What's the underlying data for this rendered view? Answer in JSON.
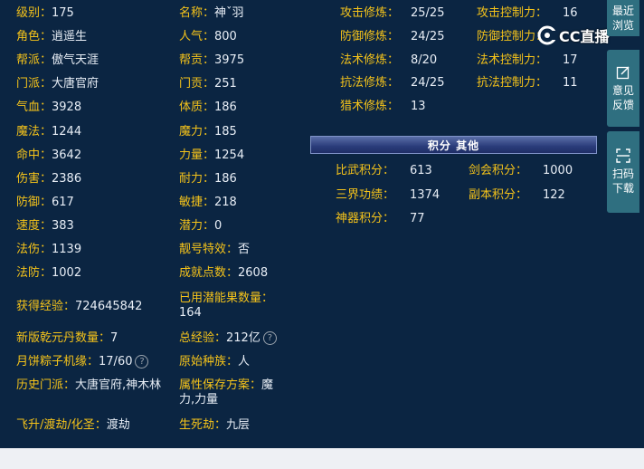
{
  "left_stats": [
    {
      "label": "级别：",
      "value": "175"
    },
    {
      "label": "角色：",
      "value": "逍遥生"
    },
    {
      "label": "帮派：",
      "value": "傲气天涯"
    },
    {
      "label": "门派：",
      "value": "大唐官府"
    },
    {
      "label": "气血：",
      "value": "3928"
    },
    {
      "label": "魔法：",
      "value": "1244"
    },
    {
      "label": "命中：",
      "value": "3642"
    },
    {
      "label": "伤害：",
      "value": "2386"
    },
    {
      "label": "防御：",
      "value": "617"
    },
    {
      "label": "速度：",
      "value": "383"
    },
    {
      "label": "法伤：",
      "value": "1139"
    },
    {
      "label": "法防：",
      "value": "1002"
    }
  ],
  "mid_stats": [
    {
      "label": "名称：",
      "value": "神ˇ羽"
    },
    {
      "label": "人气：",
      "value": "800"
    },
    {
      "label": "帮贡：",
      "value": "3975"
    },
    {
      "label": "门贡：",
      "value": "251"
    },
    {
      "label": "体质：",
      "value": "186"
    },
    {
      "label": "魔力：",
      "value": "185"
    },
    {
      "label": "力量：",
      "value": "1254"
    },
    {
      "label": "耐力：",
      "value": "186"
    },
    {
      "label": "敏捷：",
      "value": "218"
    },
    {
      "label": "潜力：",
      "value": "0"
    },
    {
      "label": "靓号特效：",
      "value": "否"
    },
    {
      "label": "成就点数：",
      "value": "2608"
    }
  ],
  "extra": {
    "exp_label": "获得经验：",
    "exp_value": "724645842",
    "potion_label": "已用潜能果数量：",
    "potion_value": "164",
    "qianyuan_label": "新版乾元丹数量：",
    "qianyuan_value": "7",
    "total_exp_label": "总经验：",
    "total_exp_value": "212亿",
    "mooncake_label": "月饼粽子机缘：",
    "mooncake_value": "17/60",
    "race_label": "原始种族：",
    "race_value": "人",
    "history_label": "历史门派：",
    "history_value": "大唐官府,神木林",
    "attr_save_label": "属性保存方案：",
    "attr_save_value": "魔力,力量",
    "ascend_label": "飞升/渡劫/化圣：",
    "ascend_value": "渡劫",
    "life_death_label": "生死劫：",
    "life_death_value": "九层"
  },
  "cultivation_left": [
    {
      "label": "攻击修炼：",
      "value": "25/25"
    },
    {
      "label": "防御修炼：",
      "value": "24/25"
    },
    {
      "label": "法术修炼：",
      "value": "8/20"
    },
    {
      "label": "抗法修炼：",
      "value": "24/25"
    },
    {
      "label": "猎术修炼：",
      "value": "13"
    }
  ],
  "cultivation_right": [
    {
      "label": "攻击控制力：",
      "value": "16"
    },
    {
      "label": "防御控制力：",
      "value": ""
    },
    {
      "label": "法术控制力：",
      "value": "17"
    },
    {
      "label": "抗法控制力：",
      "value": "11"
    }
  ],
  "points_header": "积分 其他",
  "points_left": [
    {
      "label": "比武积分：",
      "value": "613"
    },
    {
      "label": "三界功绩：",
      "value": "1374"
    },
    {
      "label": "神器积分：",
      "value": "77"
    }
  ],
  "points_right": [
    {
      "label": "剑会积分：",
      "value": "1000"
    },
    {
      "label": "副本积分：",
      "value": "122"
    }
  ],
  "sidebar": {
    "recent_label": "最近\n浏览",
    "feedback_label": "意见\n反馈",
    "scan_label": "扫码\n下载"
  },
  "watermark_text": "CC直播",
  "help_icon_glyph": "?"
}
